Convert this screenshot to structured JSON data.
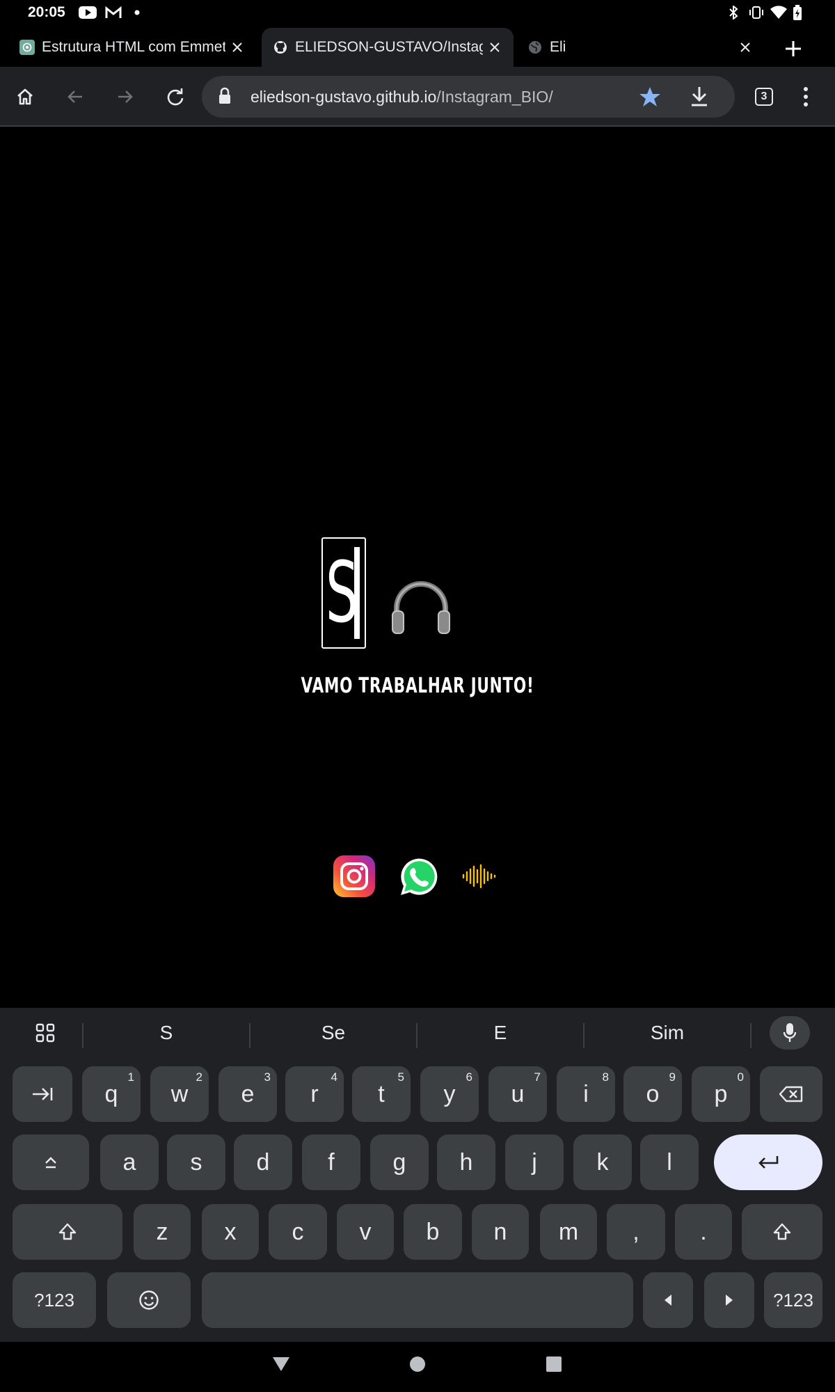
{
  "status_bar": {
    "time": "20:05"
  },
  "tabs": [
    {
      "title": "Estrutura HTML com Emmet",
      "favicon": "chatgpt-icon",
      "active": false
    },
    {
      "title": "ELIEDSON-GUSTAVO/Instagram",
      "favicon": "github-icon",
      "active": true
    },
    {
      "title": "Eli",
      "favicon": "globe-icon",
      "active": false
    }
  ],
  "toolbar": {
    "url_host": "eliedson-gustavo.github.io",
    "url_path": "/Instagram_BIO/",
    "tab_count": "3"
  },
  "page": {
    "logo_letter": "S",
    "tagline": "VAMO TRABALHAR JUNTO!",
    "social_links": [
      "instagram-icon",
      "whatsapp-icon",
      "soundwave-icon"
    ]
  },
  "keyboard": {
    "suggestions": [
      "S",
      "Se",
      "E",
      "Sim"
    ],
    "row1": [
      {
        "k": "q",
        "h": "1"
      },
      {
        "k": "w",
        "h": "2"
      },
      {
        "k": "e",
        "h": "3"
      },
      {
        "k": "r",
        "h": "4"
      },
      {
        "k": "t",
        "h": "5"
      },
      {
        "k": "y",
        "h": "6"
      },
      {
        "k": "u",
        "h": "7"
      },
      {
        "k": "i",
        "h": "8"
      },
      {
        "k": "o",
        "h": "9"
      },
      {
        "k": "p",
        "h": "0"
      }
    ],
    "row2": [
      "a",
      "s",
      "d",
      "f",
      "g",
      "h",
      "j",
      "k",
      "l"
    ],
    "row3": [
      "z",
      "x",
      "c",
      "v",
      "b",
      "n",
      "m",
      ",",
      "."
    ],
    "symbols_label": "?123"
  },
  "colors": {
    "accent": "#8ab4f8",
    "enter_key": "#e8eafe",
    "soundwave": "#f5c400"
  }
}
